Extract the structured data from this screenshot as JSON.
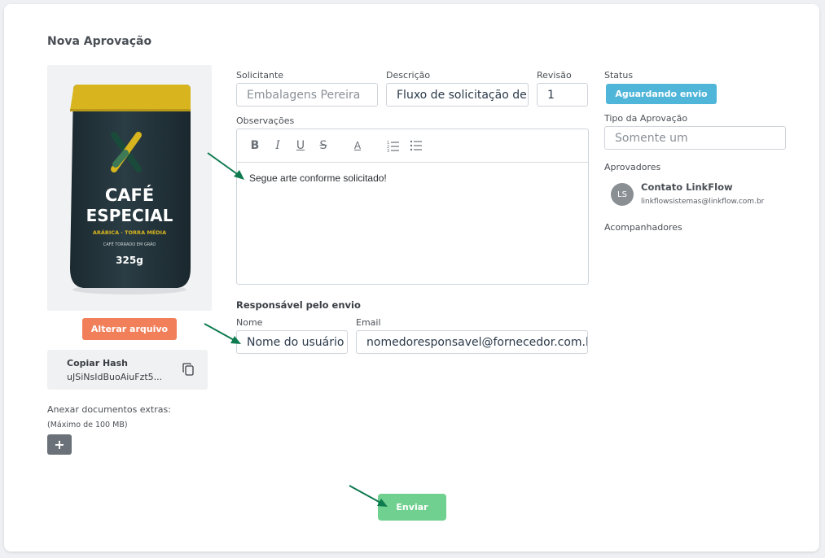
{
  "page": {
    "title": "Nova Aprovação"
  },
  "product": {
    "brand_line1": "CAFÉ",
    "brand_line2": "ESPECIAL",
    "variety": "ARÁBICA · TORRA MÉDIA",
    "subtitle": "CAFÉ TORRADO EM GRÃO",
    "weight": "325g"
  },
  "left": {
    "change_file_label": "Alterar arquivo",
    "hash_title": "Copiar Hash",
    "hash_value": "uJSiNsIdBuoAiuFzt5...",
    "extras_label": "Anexar documentos extras:",
    "extras_limit": "(Máximo de 100 MB)",
    "add_label": "+"
  },
  "form": {
    "solicitante_label": "Solicitante",
    "solicitante_value": "Embalagens Pereira",
    "descricao_label": "Descrição",
    "descricao_value": "Fluxo de solicitação de",
    "revisao_label": "Revisão",
    "revisao_value": "1",
    "observacoes_label": "Observações",
    "observacoes_text": "Segue arte conforme solicitado!",
    "responsavel_heading": "Responsável pelo envio",
    "nome_label": "Nome",
    "nome_value": "Nome do usuário",
    "email_label": "Email",
    "email_value": "nomedoresponsavel@fornecedor.com.br"
  },
  "toolbar": [
    "B",
    "I",
    "U",
    "S",
    "A"
  ],
  "right": {
    "status_label": "Status",
    "status_value": "Aguardando envio",
    "tipo_label": "Tipo da Aprovação",
    "tipo_value": "Somente um",
    "aprovadores_label": "Aprovadores",
    "approver_initials": "LS",
    "approver_name": "Contato LinkFlow",
    "approver_email": "linkflowsistemas@linkflow.com.br",
    "acompanhadores_label": "Acompanhadores"
  },
  "footer": {
    "send_label": "Enviar"
  },
  "colors": {
    "accent_orange": "#f07f5a",
    "status_blue": "#4fb6d9",
    "send_green": "#6fd08f",
    "arrow_green": "#0e7a4f",
    "bag_dark": "#22333a",
    "bag_gold": "#d8b51e"
  }
}
